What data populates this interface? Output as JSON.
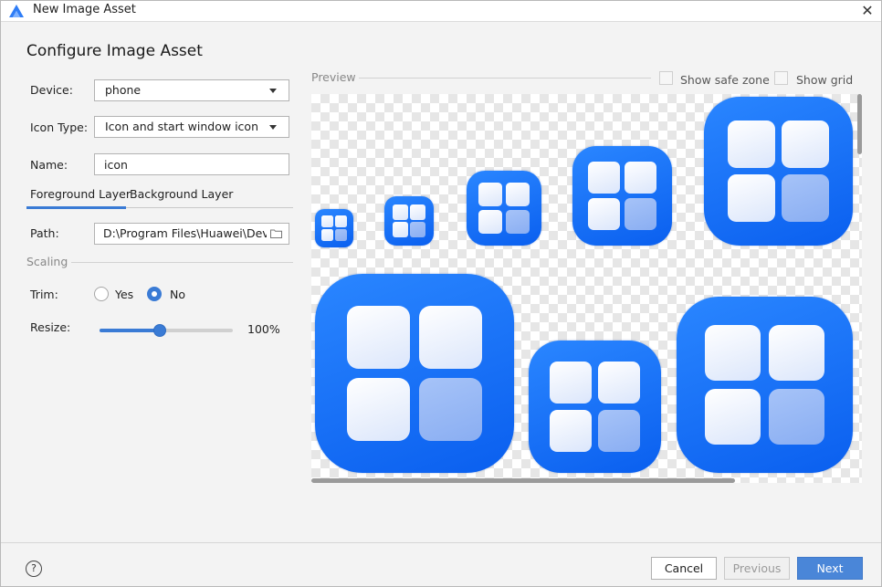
{
  "window": {
    "title": "New Image Asset",
    "close_icon": "close-icon"
  },
  "heading": "Configure Image Asset",
  "form": {
    "device_label": "Device:",
    "device_value": "phone",
    "icon_type_label": "Icon Type:",
    "icon_type_value": "Icon and start window icon",
    "name_label": "Name:",
    "name_value": "icon",
    "tabs": [
      {
        "label": "Foreground Layer",
        "active": true
      },
      {
        "label": "Background Layer",
        "active": false
      }
    ],
    "path_label": "Path:",
    "path_value": "D:\\Program Files\\Huawei\\DevEco",
    "scaling_label": "Scaling",
    "trim_label": "Trim:",
    "trim_yes": "Yes",
    "trim_no": "No",
    "trim_selected": "No",
    "resize_label": "Resize:",
    "resize_value": "100%",
    "resize_percent": 100
  },
  "preview": {
    "label": "Preview",
    "show_safe_zone": "Show safe zone",
    "show_grid": "Show grid",
    "show_safe_zone_checked": false,
    "show_grid_checked": false
  },
  "footer": {
    "help": "?",
    "cancel": "Cancel",
    "previous": "Previous",
    "next": "Next"
  },
  "colors": {
    "accent": "#3a7bd5",
    "tile_blue": "#0a5fef",
    "primary_button": "#4a86d8"
  }
}
